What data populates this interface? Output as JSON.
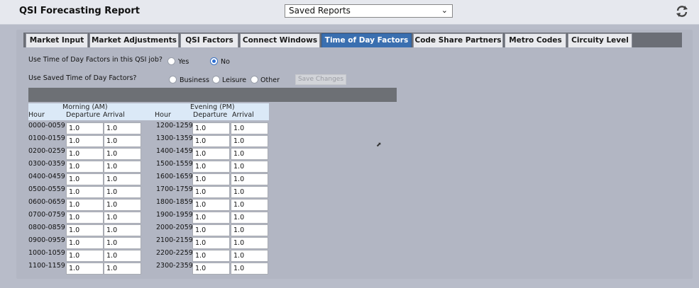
{
  "app": {
    "title": "QSI Forecasting Report"
  },
  "saved_reports": {
    "selected": "Saved Reports"
  },
  "tabs": [
    {
      "label": "Market Input",
      "active": false
    },
    {
      "label": "Market Adjustments",
      "active": false
    },
    {
      "label": "QSI Factors",
      "active": false
    },
    {
      "label": "Connect Windows",
      "active": false
    },
    {
      "label": "Time of Day Factors",
      "active": true
    },
    {
      "label": "Code Share Partners",
      "active": false
    },
    {
      "label": "Metro Codes",
      "active": false
    },
    {
      "label": "Circuity Level",
      "active": false
    }
  ],
  "question1": {
    "label": "Use Time of Day Factors in this QSI job?",
    "options": [
      {
        "label": "Yes",
        "checked": false
      },
      {
        "label": "No",
        "checked": true
      }
    ]
  },
  "question2": {
    "label": "Use Saved Time of Day Factors?",
    "options": [
      {
        "label": "Business",
        "checked": false
      },
      {
        "label": "Leisure",
        "checked": false
      },
      {
        "label": "Other",
        "checked": false
      }
    ],
    "save_button": "Save Changes"
  },
  "table": {
    "am_header": "Morning (AM)",
    "pm_header": "Evening (PM)",
    "hour_label": "Hour",
    "departure_label": "Departure",
    "arrival_label": "Arrival",
    "am_rows": [
      {
        "hour": "0000-0059",
        "departure": "1.0",
        "arrival": "1.0"
      },
      {
        "hour": "0100-0159",
        "departure": "1.0",
        "arrival": "1.0"
      },
      {
        "hour": "0200-0259",
        "departure": "1.0",
        "arrival": "1.0"
      },
      {
        "hour": "0300-0359",
        "departure": "1.0",
        "arrival": "1.0"
      },
      {
        "hour": "0400-0459",
        "departure": "1.0",
        "arrival": "1.0"
      },
      {
        "hour": "0500-0559",
        "departure": "1.0",
        "arrival": "1.0"
      },
      {
        "hour": "0600-0659",
        "departure": "1.0",
        "arrival": "1.0"
      },
      {
        "hour": "0700-0759",
        "departure": "1.0",
        "arrival": "1.0"
      },
      {
        "hour": "0800-0859",
        "departure": "1.0",
        "arrival": "1.0"
      },
      {
        "hour": "0900-0959",
        "departure": "1.0",
        "arrival": "1.0"
      },
      {
        "hour": "1000-1059",
        "departure": "1.0",
        "arrival": "1.0"
      },
      {
        "hour": "1100-1159",
        "departure": "1.0",
        "arrival": "1.0"
      }
    ],
    "pm_rows": [
      {
        "hour": "1200-1259",
        "departure": "1.0",
        "arrival": "1.0"
      },
      {
        "hour": "1300-1359",
        "departure": "1.0",
        "arrival": "1.0"
      },
      {
        "hour": "1400-1459",
        "departure": "1.0",
        "arrival": "1.0"
      },
      {
        "hour": "1500-1559",
        "departure": "1.0",
        "arrival": "1.0"
      },
      {
        "hour": "1600-1659",
        "departure": "1.0",
        "arrival": "1.0"
      },
      {
        "hour": "1700-1759",
        "departure": "1.0",
        "arrival": "1.0"
      },
      {
        "hour": "1800-1859",
        "departure": "1.0",
        "arrival": "1.0"
      },
      {
        "hour": "1900-1959",
        "departure": "1.0",
        "arrival": "1.0"
      },
      {
        "hour": "2000-2059",
        "departure": "1.0",
        "arrival": "1.0"
      },
      {
        "hour": "2100-2159",
        "departure": "1.0",
        "arrival": "1.0"
      },
      {
        "hour": "2200-2259",
        "departure": "1.0",
        "arrival": "1.0"
      },
      {
        "hour": "2300-2359",
        "departure": "1.0",
        "arrival": "1.0"
      }
    ]
  },
  "colors": {
    "active_tab": "#3a6fb0",
    "radio_checked": "#2f6fd3",
    "header_bg": "#dbe9f7"
  },
  "icons": {
    "refresh": "refresh-icon",
    "dropdown": "chevron-down-icon"
  }
}
